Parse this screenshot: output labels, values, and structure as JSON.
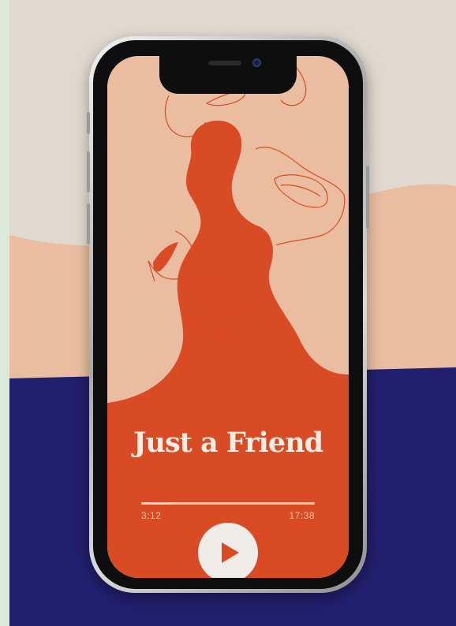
{
  "player": {
    "title": "Just a Friend",
    "elapsed": "3:12",
    "duration": "17:38",
    "progress_fraction": 0.18
  },
  "colors": {
    "accent": "#d94b25",
    "peach": "#eabda1",
    "navy": "#221f6e",
    "sand": "#e0d9cf",
    "mint": "#dde9d8",
    "button": "#efebe7"
  },
  "icons": {
    "play": "play-icon"
  }
}
